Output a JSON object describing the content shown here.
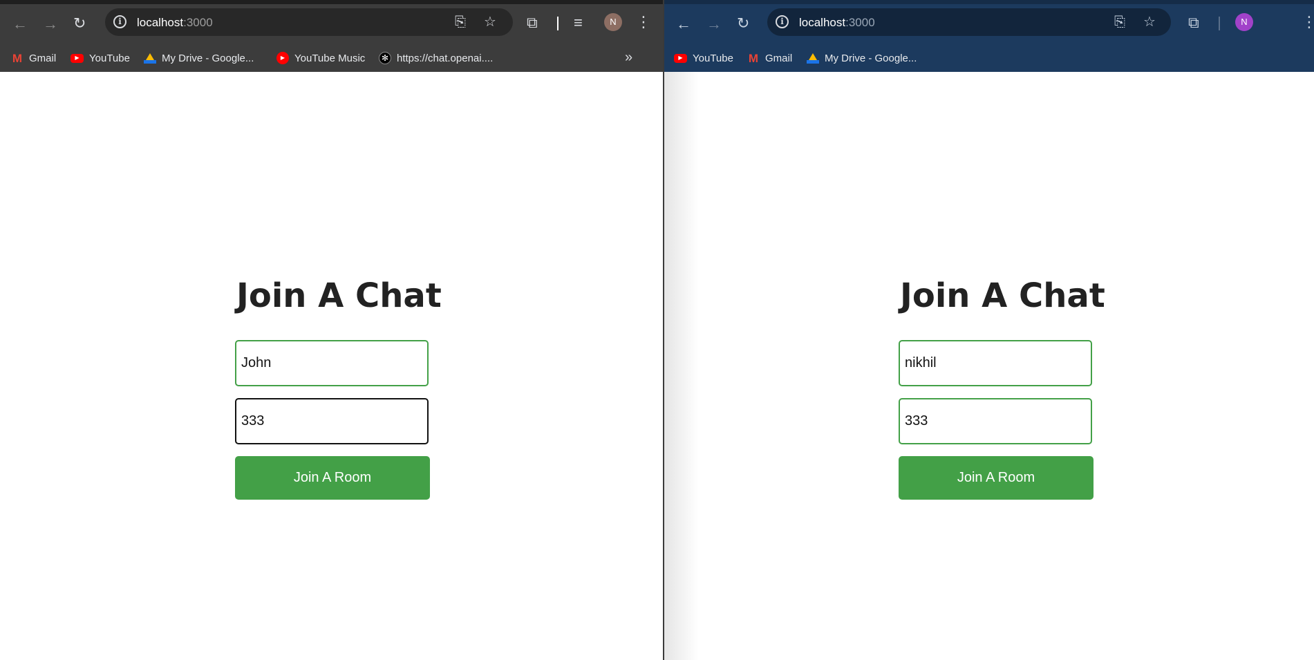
{
  "left_window": {
    "url_host": "localhost",
    "url_port": ":3000",
    "avatar_initial": "N",
    "avatar_color": "#8d6e63",
    "bookmarks": [
      {
        "label": "Gmail",
        "icon": "gmail-icon"
      },
      {
        "label": "YouTube",
        "icon": "youtube-icon"
      },
      {
        "label": "My Drive - Google...",
        "icon": "google-drive-icon"
      },
      {
        "label": "YouTube Music",
        "icon": "youtube-music-icon"
      },
      {
        "label": "https://chat.openai....",
        "icon": "openai-icon"
      }
    ],
    "page": {
      "title": "Join A Chat",
      "name_value": "John",
      "room_value": "333",
      "button_label": "Join A Room"
    }
  },
  "right_window": {
    "url_host": "localhost",
    "url_port": ":3000",
    "avatar_initial": "N",
    "avatar_color": "#a142c9",
    "bookmarks": [
      {
        "label": "YouTube",
        "icon": "youtube-icon"
      },
      {
        "label": "Gmail",
        "icon": "gmail-icon"
      },
      {
        "label": "My Drive - Google...",
        "icon": "google-drive-icon"
      }
    ],
    "page": {
      "title": "Join A Chat",
      "name_value": "nikhil",
      "room_value": "333",
      "button_label": "Join A Room"
    }
  },
  "colors": {
    "accent_green": "#43a047",
    "left_chrome": "#3c3c3c",
    "right_chrome": "#1c3a5e"
  }
}
